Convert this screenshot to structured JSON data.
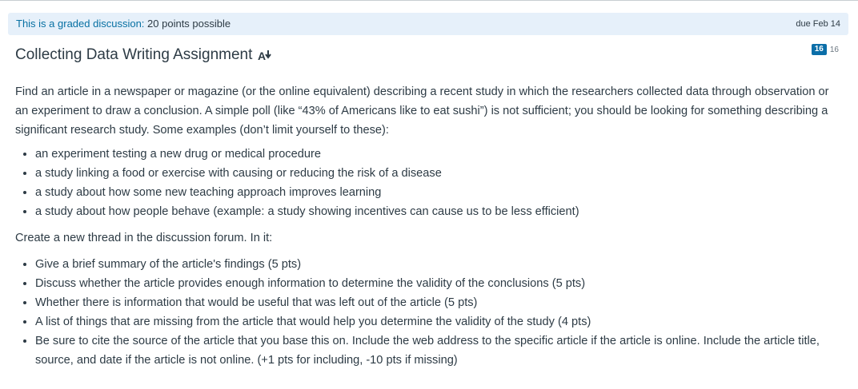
{
  "banner": {
    "graded_prefix": "This is a graded discussion:",
    "points": "20 points possible",
    "due": "due Feb 14"
  },
  "title": "Collecting Data Writing Assignment",
  "counts": {
    "unread": "16",
    "total": "16"
  },
  "intro": "Find an article in a newspaper or magazine (or the online equivalent) describing a recent study in which the researchers collected data through observation or an experiment to draw a conclusion.  A simple poll (like “43% of Americans like to eat sushi”) is not sufficient; you should be looking for something describing a significant research study.  Some examples (don’t limit yourself to these):",
  "examples": [
    "an experiment testing a new drug or medical procedure",
    "a study linking a food or exercise with causing or reducing the risk of a disease",
    "a study about how some new teaching approach improves learning",
    "a study about how people behave (example: a study showing incentives can cause us to be less efficient)"
  ],
  "thread_intro": "Create a new thread in the discussion forum.  In it:",
  "requirements": [
    "Give a brief summary of the article's findings (5 pts)",
    "Discuss whether the article provides enough information to determine the validity of the conclusions (5 pts)",
    "Whether there is information that would be useful that was left out of the article (5 pts)",
    "A list of things that are missing from the article that would help you determine the validity of the study (4 pts)",
    "Be sure to cite the source of the article that you base this on. Include the web address to the specific article if the article is online. Include the article title, source, and date if the article is not online. (+1 pts for including, -10 pts if missing)"
  ],
  "icons": {
    "accessibility": "text-size-down-icon"
  },
  "colors": {
    "banner_bg": "#e6f0fa",
    "link": "#0770a3",
    "badge": "#0b6ea8",
    "text": "#2d3b45"
  }
}
